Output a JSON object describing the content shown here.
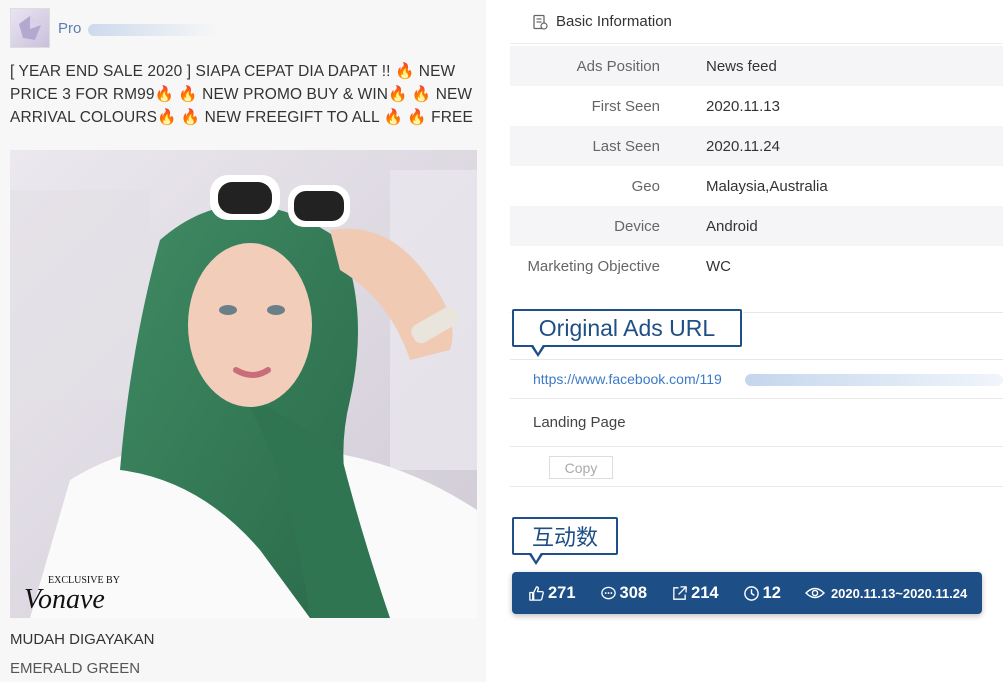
{
  "ad": {
    "page_name": "Pro",
    "text": "[ YEAR END SALE 2020 ] SIAPA CEPAT DIA DAPAT !! 🔥 NEW PRICE 3 FOR RM99🔥 🔥 NEW PROMO BUY & WIN🔥 🔥 NEW ARRIVAL COLOURS🔥 🔥 NEW FREEGIFT TO ALL 🔥 🔥 FREE",
    "image_brand_small": "EXCLUSIVE BY",
    "image_brand": "Vonave",
    "caption_1": "MUDAH DIGAYAKAN",
    "caption_2": "EMERALD GREEN"
  },
  "basic_info": {
    "title": "Basic Information",
    "rows": [
      {
        "key": "Ads Position",
        "value": "News feed"
      },
      {
        "key": "First Seen",
        "value": "2020.11.13"
      },
      {
        "key": "Last Seen",
        "value": "2020.11.24"
      },
      {
        "key": "Geo",
        "value": "Malaysia,Australia"
      },
      {
        "key": "Device",
        "value": "Android"
      },
      {
        "key": "Marketing Objective",
        "value": "WC"
      }
    ]
  },
  "original_url": {
    "callout": "Original Ads URL",
    "url": "https://www.facebook.com/119"
  },
  "landing": {
    "label": "Landing Page",
    "copy_label": "Copy"
  },
  "interactions": {
    "callout": "互动数",
    "likes": "271",
    "comments": "308",
    "shares": "214",
    "clock": "12",
    "date_range": "2020.11.13~2020.11.24"
  },
  "colors": {
    "accent": "#1d4e86",
    "link": "#3b7bc4"
  }
}
